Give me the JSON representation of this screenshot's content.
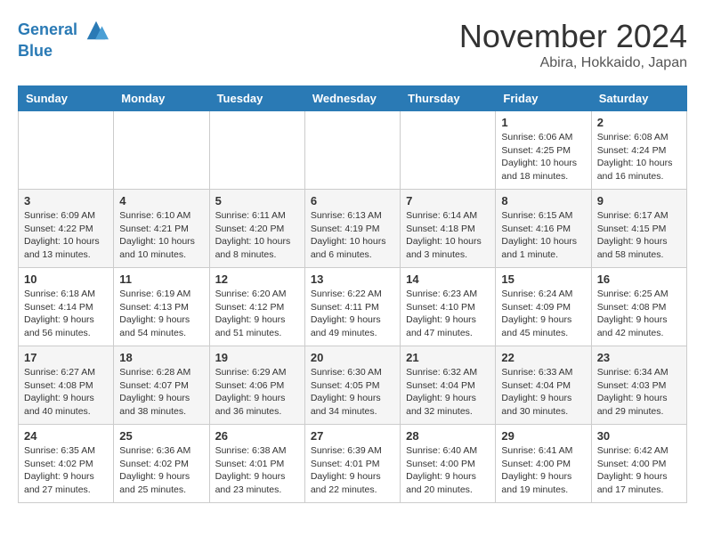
{
  "header": {
    "logo_line1": "General",
    "logo_line2": "Blue",
    "month": "November 2024",
    "location": "Abira, Hokkaido, Japan"
  },
  "days_of_week": [
    "Sunday",
    "Monday",
    "Tuesday",
    "Wednesday",
    "Thursday",
    "Friday",
    "Saturday"
  ],
  "weeks": [
    [
      {
        "day": "",
        "sunrise": "",
        "sunset": "",
        "daylight": ""
      },
      {
        "day": "",
        "sunrise": "",
        "sunset": "",
        "daylight": ""
      },
      {
        "day": "",
        "sunrise": "",
        "sunset": "",
        "daylight": ""
      },
      {
        "day": "",
        "sunrise": "",
        "sunset": "",
        "daylight": ""
      },
      {
        "day": "",
        "sunrise": "",
        "sunset": "",
        "daylight": ""
      },
      {
        "day": "1",
        "sunrise": "6:06 AM",
        "sunset": "4:25 PM",
        "daylight": "10 hours and 18 minutes."
      },
      {
        "day": "2",
        "sunrise": "6:08 AM",
        "sunset": "4:24 PM",
        "daylight": "10 hours and 16 minutes."
      }
    ],
    [
      {
        "day": "3",
        "sunrise": "6:09 AM",
        "sunset": "4:22 PM",
        "daylight": "10 hours and 13 minutes."
      },
      {
        "day": "4",
        "sunrise": "6:10 AM",
        "sunset": "4:21 PM",
        "daylight": "10 hours and 10 minutes."
      },
      {
        "day": "5",
        "sunrise": "6:11 AM",
        "sunset": "4:20 PM",
        "daylight": "10 hours and 8 minutes."
      },
      {
        "day": "6",
        "sunrise": "6:13 AM",
        "sunset": "4:19 PM",
        "daylight": "10 hours and 6 minutes."
      },
      {
        "day": "7",
        "sunrise": "6:14 AM",
        "sunset": "4:18 PM",
        "daylight": "10 hours and 3 minutes."
      },
      {
        "day": "8",
        "sunrise": "6:15 AM",
        "sunset": "4:16 PM",
        "daylight": "10 hours and 1 minute."
      },
      {
        "day": "9",
        "sunrise": "6:17 AM",
        "sunset": "4:15 PM",
        "daylight": "9 hours and 58 minutes."
      }
    ],
    [
      {
        "day": "10",
        "sunrise": "6:18 AM",
        "sunset": "4:14 PM",
        "daylight": "9 hours and 56 minutes."
      },
      {
        "day": "11",
        "sunrise": "6:19 AM",
        "sunset": "4:13 PM",
        "daylight": "9 hours and 54 minutes."
      },
      {
        "day": "12",
        "sunrise": "6:20 AM",
        "sunset": "4:12 PM",
        "daylight": "9 hours and 51 minutes."
      },
      {
        "day": "13",
        "sunrise": "6:22 AM",
        "sunset": "4:11 PM",
        "daylight": "9 hours and 49 minutes."
      },
      {
        "day": "14",
        "sunrise": "6:23 AM",
        "sunset": "4:10 PM",
        "daylight": "9 hours and 47 minutes."
      },
      {
        "day": "15",
        "sunrise": "6:24 AM",
        "sunset": "4:09 PM",
        "daylight": "9 hours and 45 minutes."
      },
      {
        "day": "16",
        "sunrise": "6:25 AM",
        "sunset": "4:08 PM",
        "daylight": "9 hours and 42 minutes."
      }
    ],
    [
      {
        "day": "17",
        "sunrise": "6:27 AM",
        "sunset": "4:08 PM",
        "daylight": "9 hours and 40 minutes."
      },
      {
        "day": "18",
        "sunrise": "6:28 AM",
        "sunset": "4:07 PM",
        "daylight": "9 hours and 38 minutes."
      },
      {
        "day": "19",
        "sunrise": "6:29 AM",
        "sunset": "4:06 PM",
        "daylight": "9 hours and 36 minutes."
      },
      {
        "day": "20",
        "sunrise": "6:30 AM",
        "sunset": "4:05 PM",
        "daylight": "9 hours and 34 minutes."
      },
      {
        "day": "21",
        "sunrise": "6:32 AM",
        "sunset": "4:04 PM",
        "daylight": "9 hours and 32 minutes."
      },
      {
        "day": "22",
        "sunrise": "6:33 AM",
        "sunset": "4:04 PM",
        "daylight": "9 hours and 30 minutes."
      },
      {
        "day": "23",
        "sunrise": "6:34 AM",
        "sunset": "4:03 PM",
        "daylight": "9 hours and 29 minutes."
      }
    ],
    [
      {
        "day": "24",
        "sunrise": "6:35 AM",
        "sunset": "4:02 PM",
        "daylight": "9 hours and 27 minutes."
      },
      {
        "day": "25",
        "sunrise": "6:36 AM",
        "sunset": "4:02 PM",
        "daylight": "9 hours and 25 minutes."
      },
      {
        "day": "26",
        "sunrise": "6:38 AM",
        "sunset": "4:01 PM",
        "daylight": "9 hours and 23 minutes."
      },
      {
        "day": "27",
        "sunrise": "6:39 AM",
        "sunset": "4:01 PM",
        "daylight": "9 hours and 22 minutes."
      },
      {
        "day": "28",
        "sunrise": "6:40 AM",
        "sunset": "4:00 PM",
        "daylight": "9 hours and 20 minutes."
      },
      {
        "day": "29",
        "sunrise": "6:41 AM",
        "sunset": "4:00 PM",
        "daylight": "9 hours and 19 minutes."
      },
      {
        "day": "30",
        "sunrise": "6:42 AM",
        "sunset": "4:00 PM",
        "daylight": "9 hours and 17 minutes."
      }
    ]
  ]
}
